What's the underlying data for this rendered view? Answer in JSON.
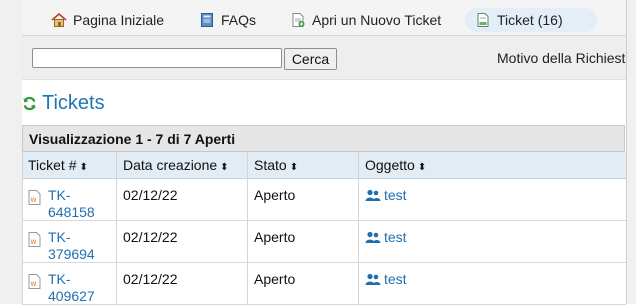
{
  "nav": {
    "items": [
      {
        "label": "Pagina Iniziale",
        "icon": "home-icon"
      },
      {
        "label": "FAQs",
        "icon": "book-icon"
      },
      {
        "label": "Apri un Nuovo Ticket",
        "icon": "new-ticket-icon"
      },
      {
        "label": "Ticket (16)",
        "icon": "document-icon"
      }
    ]
  },
  "search": {
    "value": "",
    "placeholder": "",
    "button_label": "Cerca",
    "reason_label": "Motivo della Richiest"
  },
  "section": {
    "title": "Tickets"
  },
  "table": {
    "caption": "Visualizzazione 1 - 7 di 7 Aperti",
    "headers": {
      "ticket": "Ticket #",
      "created": "Data creazione",
      "status": "Stato",
      "subject": "Oggetto"
    },
    "sort_glyph": "⬍",
    "rows": [
      {
        "ticket": "TK-648158",
        "created": "02/12/22",
        "status": "Aperto",
        "subject": "test"
      },
      {
        "ticket": "TK-379694",
        "created": "02/12/22",
        "status": "Aperto",
        "subject": "test"
      },
      {
        "ticket": "TK-409627",
        "created": "02/12/22",
        "status": "Aperto",
        "subject": "test"
      }
    ]
  },
  "colors": {
    "link": "#1f6fb0",
    "title": "#1f78b4",
    "refresh_icon": "#2e9b3a",
    "header_bg": "#e1ecf5",
    "active_tab_bg": "#e4eef8"
  }
}
